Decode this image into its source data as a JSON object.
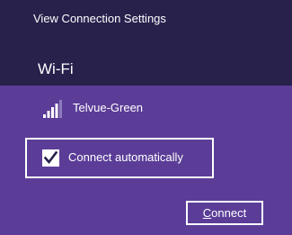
{
  "header": {
    "view_settings_label": "View Connection Settings",
    "section_title": "Wi-Fi"
  },
  "network": {
    "name": "Telvue-Green",
    "signal_icon": "wifi-signal-icon",
    "signal_bars": 5,
    "signal_strength": 4
  },
  "auto_connect": {
    "label": "Connect automatically",
    "checked": true,
    "check_icon": "checkmark-icon"
  },
  "connect_button": {
    "access_key": "C",
    "label_rest": "onnect"
  },
  "colors": {
    "header_background": "#27214c",
    "panel_background": "#5b3d97",
    "text": "#ffffff",
    "signal_active": "#ffffff",
    "signal_inactive": "#8e7bbd",
    "check_mark": "#27214c"
  }
}
